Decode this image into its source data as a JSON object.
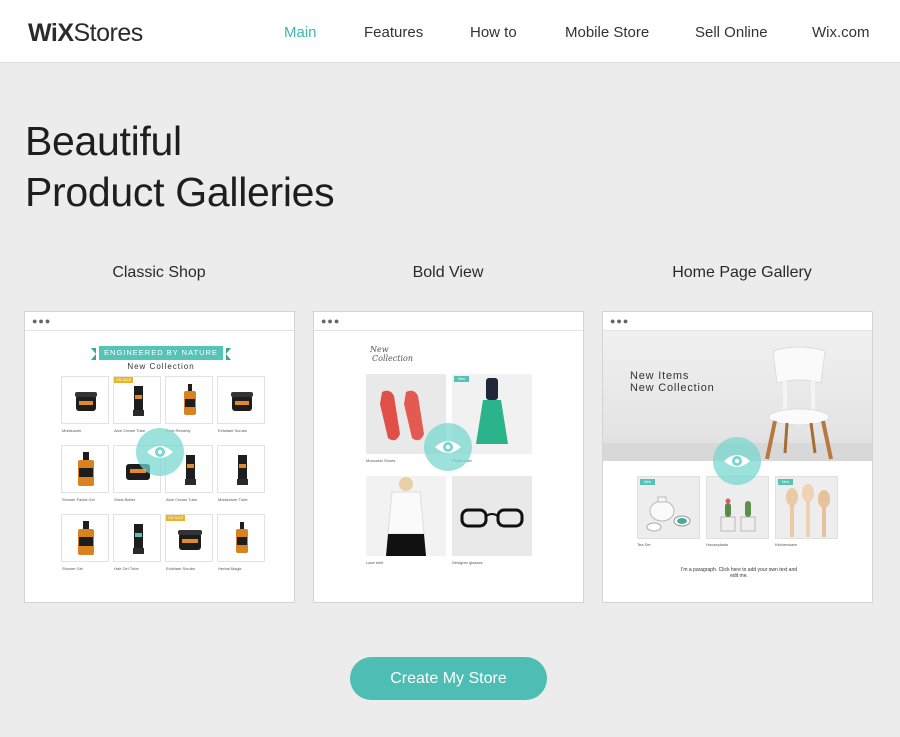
{
  "header": {
    "logo_bold": "WiX",
    "logo_light": "Stores",
    "nav": [
      "Main",
      "Features",
      "How to",
      "Mobile Store",
      "Sell Online",
      "Wix.com"
    ],
    "active_nav": "Main"
  },
  "hero": {
    "line1": "Beautiful",
    "line2": "Product Galleries"
  },
  "galleries": {
    "classic": {
      "title": "Classic Shop",
      "ribbon": "ENGINEERED BY NATURE",
      "subtitle": "New Collection",
      "products": [
        "Moisturizer",
        "Aloe Cream Tube",
        "Pure Remedy",
        "Exfoliant Scrubs",
        "Shower Facial Gel",
        "Shea Butter",
        "Aloe Cream Tube",
        "Moisturizer Tube",
        "Shower Gel",
        "Hair Gel Tube",
        "Exfoliant Scrubs",
        "Herbal Magic"
      ],
      "sale_label": "ON SALE"
    },
    "bold": {
      "title": "Bold View",
      "script_line1": "New",
      "script_line2": "Collection",
      "new_label": "New",
      "products": [
        "Moccasin Shoes",
        "Pleats skirt",
        "Lace shirt",
        "Designer glasses"
      ]
    },
    "homepage": {
      "title": "Home Page Gallery",
      "hero_line1": "New Items",
      "hero_line2": "New Collection",
      "new_label": "New",
      "products": [
        "Tea Set",
        "Houseplants",
        "Kitchenware"
      ],
      "paragraph": "I'm a paragraph. Click here to add your own text and edit me."
    }
  },
  "cta": {
    "label": "Create My Store"
  },
  "colors": {
    "accent": "#4ebdb3",
    "nav_active": "#3fb5b1",
    "sale": "#e8b52a",
    "background": "#ececec"
  },
  "icons": [
    "eye-icon",
    "window-dots-icon"
  ]
}
